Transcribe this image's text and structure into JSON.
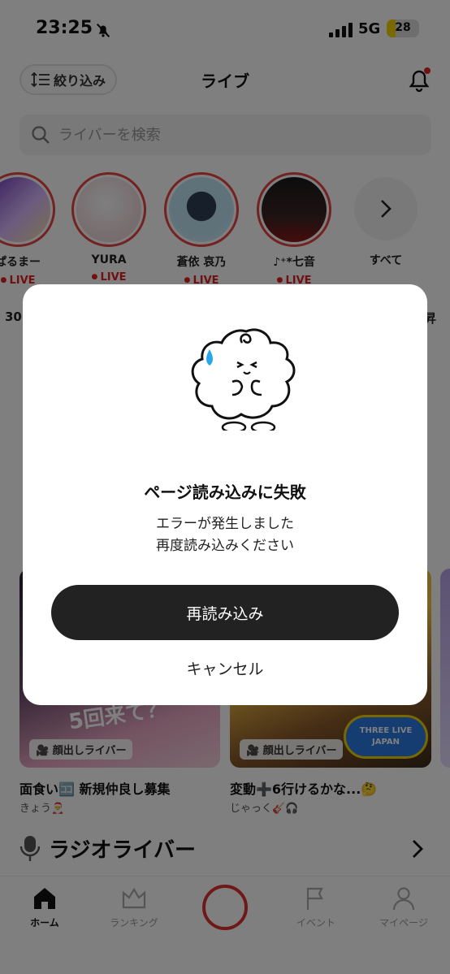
{
  "status_bar": {
    "time": "23:25",
    "network": "5G",
    "battery": "28",
    "battery_level": 0.28
  },
  "header": {
    "filter_label": "絞り込み",
    "title": "ライブ"
  },
  "search": {
    "placeholder": "ライバーを検索"
  },
  "stories": [
    {
      "name": "ぱるまー",
      "live": "LIVE",
      "color": "#7a3fbf"
    },
    {
      "name": "YURA",
      "live": "LIVE",
      "color": "#f3e6e8"
    },
    {
      "name": "蒼依 哀乃",
      "live": "LIVE",
      "color": "#bfe3f3"
    },
    {
      "name": "♪⁺*七音",
      "live": "LIVE",
      "color": "#2a1a1a"
    }
  ],
  "stories_more": "すべて",
  "row_prefix": "30",
  "row_suffix": "昇",
  "cards": [
    {
      "badge": "顔出しライバー",
      "title": "面食い🈁 新規仲良し募集",
      "sub": "きょう🎅"
    },
    {
      "badge": "顔出しライバー",
      "title": "変動➕6行けるかな...🤔",
      "sub": "じゃっく🎸🎧"
    }
  ],
  "banner_text": "THREE LIVE JAPAN",
  "card_overlay_text": "5回来て？",
  "section": {
    "title": "ラジオライバー"
  },
  "tabs": [
    {
      "label": "ホーム",
      "icon": "home-icon",
      "active": true
    },
    {
      "label": "ランキング",
      "icon": "crown-icon",
      "active": false
    },
    {
      "label": "イベント",
      "icon": "flag-icon",
      "active": false
    },
    {
      "label": "マイページ",
      "icon": "person-icon",
      "active": false
    }
  ],
  "dialog": {
    "title": "ページ読み込みに失敗",
    "message_line1": "エラーが発生しました",
    "message_line2": "再度読み込みください",
    "reload_label": "再読み込み",
    "cancel_label": "キャンセル"
  }
}
